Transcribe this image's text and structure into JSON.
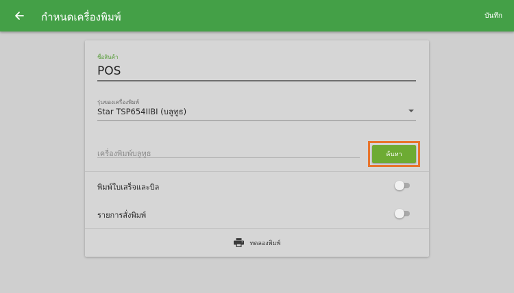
{
  "appbar": {
    "title": "กำหนดเครื่องพิมพ์",
    "save_label": "บันทึก",
    "back_icon": "arrow-left-icon",
    "color": "#44a047"
  },
  "form": {
    "product_name": {
      "label": "ชื่อสินค้า",
      "value": "POS"
    },
    "printer_model": {
      "label": "รุ่นของเครื่องพิมพ์",
      "value": "Star TSP654IIBI (บลูทูธ)"
    },
    "bluetooth_printer": {
      "placeholder": "เครื่องพิมพ์บลูทูธ",
      "search_label": "ค้นหา",
      "search_color": "#6dab33",
      "highlight_color": "#e8742c"
    },
    "toggles": [
      {
        "label": "พิมพ์ใบเสร็จและบิล",
        "on": false
      },
      {
        "label": "รายการสั่งพิมพ์",
        "on": false
      }
    ],
    "test_print": {
      "label": "ทดลองพิมพ์",
      "icon": "printer-icon"
    }
  }
}
